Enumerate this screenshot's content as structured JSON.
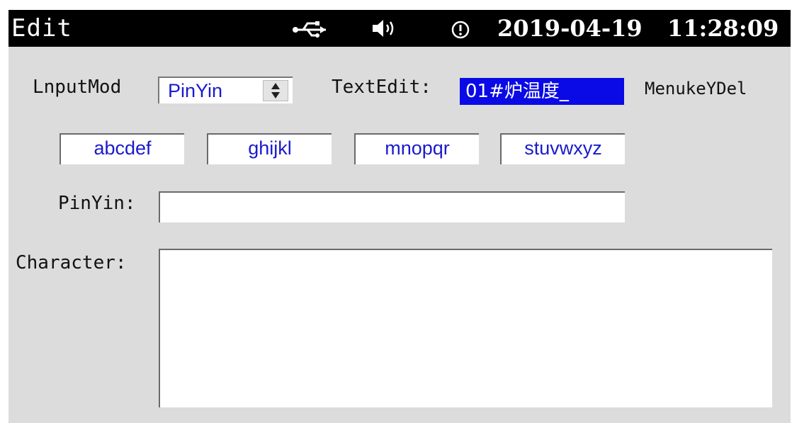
{
  "header": {
    "title": "Edit",
    "date": "2019-04-19",
    "time": "11:28:09",
    "icons": [
      "usb-icon",
      "speaker-icon",
      "alert-icon"
    ]
  },
  "input_mode": {
    "label": "LnputMod",
    "value": "PinYin"
  },
  "text_edit": {
    "label": "TextEdit:",
    "value": "01#炉温度_"
  },
  "menu_key_del": "MenukeYDel",
  "keys": [
    {
      "label": "abcdef"
    },
    {
      "label": "ghijkl"
    },
    {
      "label": "mnopqr"
    },
    {
      "label": "stuvwxyz"
    }
  ],
  "pinyin": {
    "label": "PinYin:",
    "value": ""
  },
  "character": {
    "label": "Character:",
    "value": ""
  },
  "colors": {
    "title_bar": "#000000",
    "background": "#dcdcdc",
    "accent_text": "#1a1acc",
    "selection": "#0a0ae6"
  }
}
